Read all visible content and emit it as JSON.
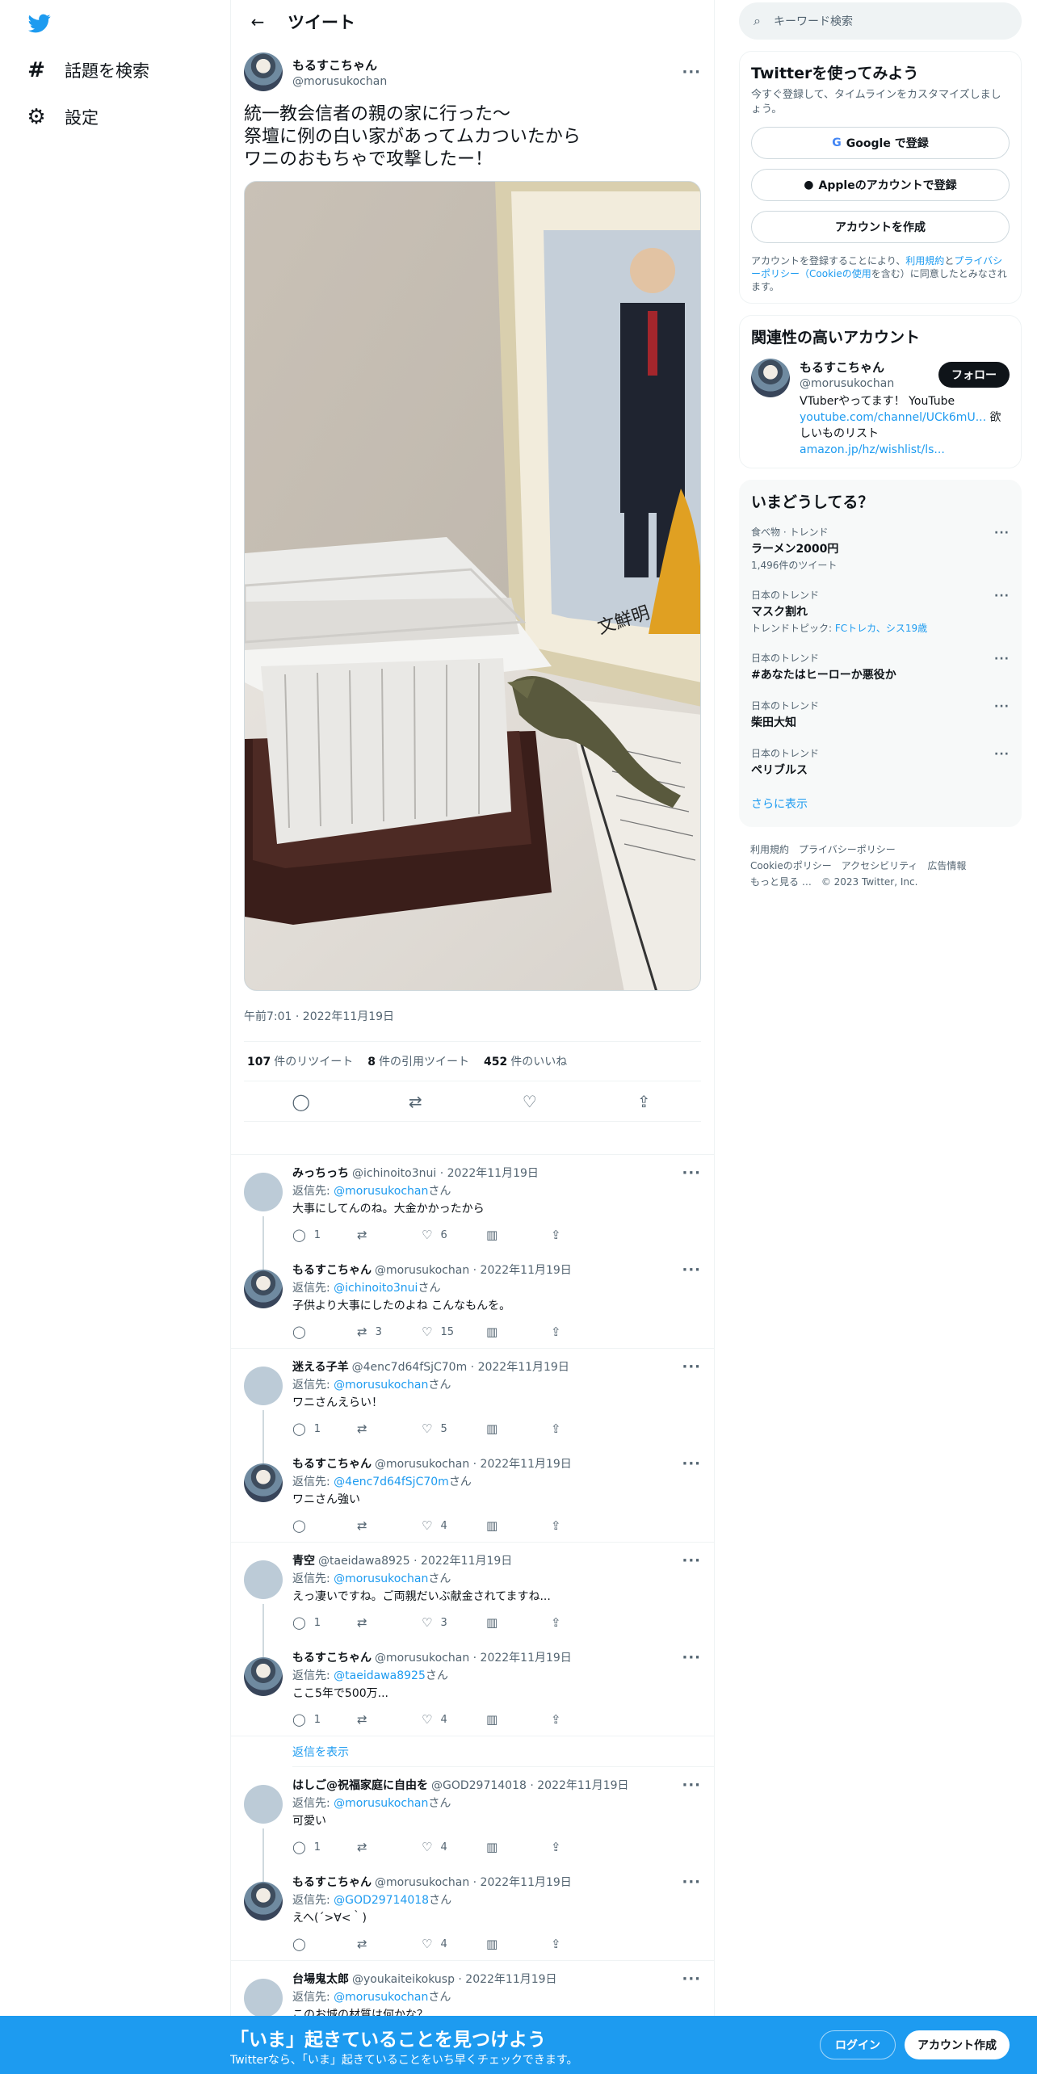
{
  "nav": {
    "explore_label": "話題を検索",
    "settings_label": "設定"
  },
  "header": {
    "title": "ツイート"
  },
  "tweet": {
    "name": "もるすこちゃん",
    "handle": "@morusukochan",
    "text": "統一教会信者の親の家に行った〜\n祭壇に例の白い家があってムカついたから\nワニのおもちゃで攻撃したー！",
    "photo_signature": "文鮮明",
    "time": "午前7:01 · 2022年11月19日",
    "stats": {
      "retweets_count": "107",
      "retweets_label": "件のリツイート",
      "quotes_count": "8",
      "quotes_label": "件の引用ツイート",
      "likes_count": "452",
      "likes_label": "件のいいね"
    }
  },
  "replies": [
    {
      "name": "みっちっち",
      "meta": "@ichinoito3nui · 2022年11月19日",
      "to_prefix": "返信先: ",
      "to": "@morusukochan",
      "to_suffix": "さん",
      "text": "大事にしてんのね。大金かかったから",
      "reply": "1",
      "rt": "",
      "like": "6",
      "avatar": "gray",
      "thread": true
    },
    {
      "name": "もるすこちゃん",
      "meta": "@morusukochan · 2022年11月19日",
      "to_prefix": "返信先: ",
      "to": "@ichinoito3nui",
      "to_suffix": "さん",
      "text": "子供より大事にしたのよね こんなもんを。",
      "reply": "",
      "rt": "3",
      "like": "15",
      "avatar": "user",
      "thread": false
    },
    {
      "name": "迷える子羊",
      "meta": "@4enc7d64fSjC70m · 2022年11月19日",
      "to_prefix": "返信先: ",
      "to": "@morusukochan",
      "to_suffix": "さん",
      "text": "ワニさんえらい！",
      "reply": "1",
      "rt": "",
      "like": "5",
      "avatar": "gray",
      "thread": true
    },
    {
      "name": "もるすこちゃん",
      "meta": "@morusukochan · 2022年11月19日",
      "to_prefix": "返信先: ",
      "to": "@4enc7d64fSjC70m",
      "to_suffix": "さん",
      "text": "ワニさん強い",
      "reply": "",
      "rt": "",
      "like": "4",
      "avatar": "user",
      "thread": false
    },
    {
      "name": "青空",
      "meta": "@taeidawa8925 · 2022年11月19日",
      "to_prefix": "返信先: ",
      "to": "@morusukochan",
      "to_suffix": "さん",
      "text": "えっ凄いですね。ご両親だいぶ献金されてますね...",
      "reply": "1",
      "rt": "",
      "like": "3",
      "avatar": "gray",
      "thread": true
    },
    {
      "name": "もるすこちゃん",
      "meta": "@morusukochan · 2022年11月19日",
      "to_prefix": "返信先: ",
      "to": "@taeidawa8925",
      "to_suffix": "さん",
      "text": "ここ5年で500万...",
      "reply": "1",
      "rt": "",
      "like": "4",
      "avatar": "user",
      "thread": false
    },
    {
      "name": "はしご@祝福家庭に自由を",
      "meta": "@GOD29714018 · 2022年11月19日",
      "to_prefix": "返信先: ",
      "to": "@morusukochan",
      "to_suffix": "さん",
      "text": "可愛い",
      "reply": "1",
      "rt": "",
      "like": "4",
      "avatar": "gray",
      "thread": true
    },
    {
      "name": "もるすこちゃん",
      "meta": "@morusukochan · 2022年11月19日",
      "to_prefix": "返信先: ",
      "to": "@GOD29714018",
      "to_suffix": "さん",
      "text": "えへ(´>∀<｀)",
      "reply": "",
      "rt": "",
      "like": "4",
      "avatar": "user",
      "thread": false
    },
    {
      "name": "台場鬼太郎",
      "meta": "@youkaiteikokusp · 2022年11月19日",
      "to_prefix": "返信先: ",
      "to": "@morusukochan",
      "to_suffix": "さん",
      "text": "このお城の材質は何かな？",
      "reply": "",
      "rt": "",
      "like": "",
      "avatar": "gray",
      "thread": false
    }
  ],
  "show_replies_label": "返信を表示",
  "search": {
    "placeholder": "キーワード検索"
  },
  "signup": {
    "title": "Twitterを使ってみよう",
    "sub": "今すぐ登録して、タイムラインをカスタマイズしましょう。",
    "google": "Google で登録",
    "apple": "Appleのアカウントで登録",
    "create": "アカウントを作成",
    "legal_1": "アカウントを登録することにより、",
    "legal_terms": "利用規約",
    "legal_2": "と",
    "legal_privacy": "プライバシーポリシー（Cookieの使用",
    "legal_3": "を含む）に同意したとみなされます。"
  },
  "relevant": {
    "title": "関連性の高いアカウント",
    "name": "もるすこちゃん",
    "handle": "@morusukochan",
    "follow": "フォロー",
    "bio_1": "VTuberやってます！ YouTube",
    "bio_link1": "youtube.com/channel/UCk6mU...",
    "bio_2": " 欲しいものリスト",
    "bio_link2": "amazon.jp/hz/wishlist/ls..."
  },
  "trends": {
    "title": "いまどうしてる？",
    "items": [
      {
        "cat": "食べ物 · トレンド",
        "title": "ラーメン2000円",
        "count": "1,496件のツイート"
      },
      {
        "cat": "日本のトレンド",
        "title": "マスク割れ",
        "count_prefix": "トレンドトピック: ",
        "count_links": "FCトレカ、シス19歳"
      },
      {
        "cat": "日本のトレンド",
        "title": "#あなたはヒーローか悪役か"
      },
      {
        "cat": "日本のトレンド",
        "title": "柴田大知"
      },
      {
        "cat": "日本のトレンド",
        "title": "ペリブルス"
      }
    ],
    "more": "さらに表示"
  },
  "footer": {
    "terms": "利用規約",
    "privacy": "プライバシーポリシー",
    "cookie": "Cookieのポリシー",
    "access": "アクセシビリティ",
    "ads": "広告情報",
    "more": "もっと見る …",
    "copyright": "© 2023 Twitter, Inc."
  },
  "bottombar": {
    "title": "「いま」起きていることを見つけよう",
    "sub": "Twitterなら、「いま」起きていることをいち早くチェックできます。",
    "login": "ログイン",
    "signup": "アカウント作成"
  },
  "colors": {
    "accent": "#1d9bf0",
    "text": "#0f1419",
    "muted": "#536471"
  }
}
